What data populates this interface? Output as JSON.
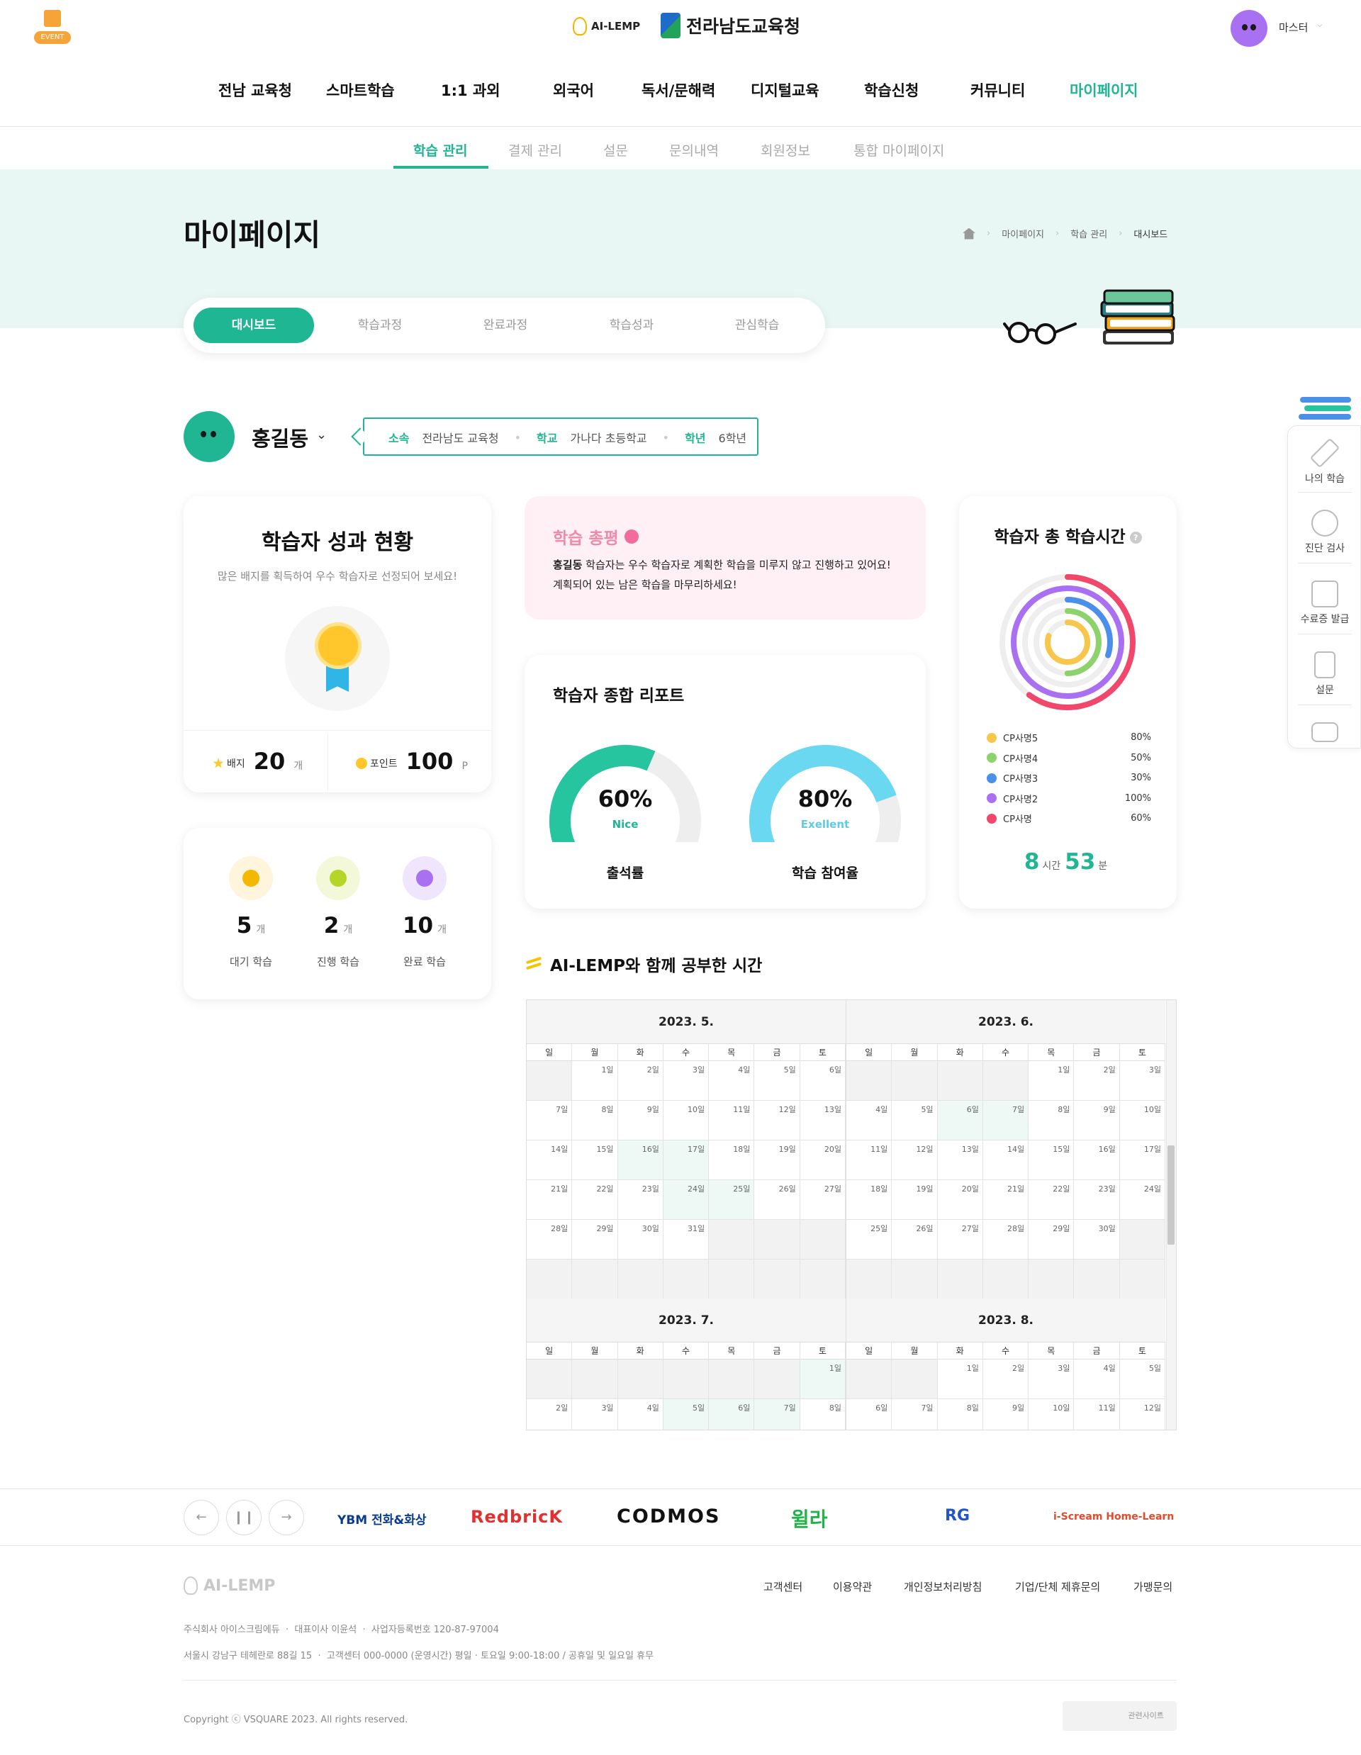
{
  "header": {
    "event_badge": "EVENT",
    "logo_ai": "AI-LEMP",
    "logo_edu": "전라남도교육청",
    "user_name": "마스터"
  },
  "gnb": [
    "전남 교육청",
    "스마트학습",
    "1:1 과외",
    "외국어",
    "독서/문해력",
    "디지털교육",
    "학습신청",
    "커뮤니티",
    "마이페이지"
  ],
  "lnb": [
    "학습 관리",
    "결제 관리",
    "설문",
    "문의내역",
    "회원정보",
    "통합 마이페이지"
  ],
  "page": {
    "title": "마이페이지",
    "breadcrumb": [
      "마이페이지",
      "학습 관리",
      "대시보드"
    ]
  },
  "tabs": [
    "대시보드",
    "학습과정",
    "완료과정",
    "학습성과",
    "관심학습"
  ],
  "profile": {
    "name": "홍길동",
    "affiliation_label": "소속",
    "affiliation": "전라남도 교육청",
    "school_label": "학교",
    "school": "가나다 초등학교",
    "grade_label": "학년",
    "grade": "6학년"
  },
  "performance": {
    "title": "학습자 성과 현황",
    "subtitle": "많은 배지를 획득하여 우수 학습자로 선정되어 보세요!",
    "badge_label": "배지",
    "badge_count": "20",
    "badge_unit": "개",
    "point_label": "포인트",
    "point_count": "100",
    "point_unit": "P"
  },
  "counts": [
    {
      "num": "5",
      "unit": "개",
      "label": "대기 학습",
      "color": "#f5b800",
      "bg": "#fff4dc"
    },
    {
      "num": "2",
      "unit": "개",
      "label": "진행 학습",
      "color": "#b5d629",
      "bg": "#f3f8d8"
    },
    {
      "num": "10",
      "unit": "개",
      "label": "완료 학습",
      "color": "#a971f2",
      "bg": "#efe5fc"
    }
  ],
  "review": {
    "title": "학습 총평",
    "name": "홍길동",
    "body": " 학습자는 우수 학습자로 계획한 학습을 미루지 않고 진행하고 있어요! 계획되어 있는 남은 학습을 마무리하세요!"
  },
  "report": {
    "title": "학습자 종합 리포트",
    "gauges": [
      {
        "value": 0.6,
        "pct": "60%",
        "word": "Nice",
        "label": "출석률",
        "color": "#27c4a0",
        "word_color": "#20b693"
      },
      {
        "value": 0.8,
        "pct": "80%",
        "word": "Exellent",
        "label": "학습 참여율",
        "color": "#6bd8f2",
        "word_color": "#5dcbe8"
      }
    ]
  },
  "study_time": {
    "title": "학습자 총 학습시간",
    "help_icon": "?",
    "legend": [
      {
        "name": "CP사명5",
        "value": "80%",
        "frac": 0.8,
        "color": "#f8c64a"
      },
      {
        "name": "CP사명4",
        "value": "50%",
        "frac": 0.5,
        "color": "#8ed26b"
      },
      {
        "name": "CP사명3",
        "value": "30%",
        "frac": 0.3,
        "color": "#4a8fe8"
      },
      {
        "name": "CP사명2",
        "value": "100%",
        "frac": 1.0,
        "color": "#a971f2"
      },
      {
        "name": "CP사명",
        "value": "60%",
        "frac": 0.6,
        "color": "#f0476b"
      }
    ],
    "hours": "8",
    "hours_unit": "시간",
    "minutes": "53",
    "minutes_unit": "분"
  },
  "calendar": {
    "title": "AI-LEMP와 함께 공부한 시간",
    "weekdays": [
      "일",
      "월",
      "화",
      "수",
      "목",
      "금",
      "토"
    ],
    "months": [
      {
        "label": "2023. 5.",
        "offset": 1,
        "days": 31,
        "highlight": [
          16,
          17,
          24,
          25
        ]
      },
      {
        "label": "2023. 6.",
        "offset": 4,
        "days": 30,
        "highlight": [
          6,
          7
        ]
      },
      {
        "label": "2023. 7.",
        "offset": 6,
        "days": 31,
        "highlight": [
          1,
          5,
          6,
          7
        ]
      },
      {
        "label": "2023. 8.",
        "offset": 2,
        "days": 31,
        "highlight": []
      }
    ],
    "day_suffix": "일"
  },
  "quick_menu": [
    "나의 학습",
    "진단 검사",
    "수료증 발급",
    "설문"
  ],
  "partners": [
    "YBM 전화&화상",
    "RedbricK",
    "CODMOS",
    "윌라",
    "RG",
    "i-Scream Home-Learn"
  ],
  "footer": {
    "logo": "AI-LEMP",
    "links": [
      "고객센터",
      "이용약관",
      "개인정보처리방침",
      "기업/단체 제휴문의",
      "가맹문의"
    ],
    "company": "주식회사 아이스크림에듀",
    "ceo": "대표이사 이윤석",
    "biz_no": "사업자등록번호 120-87-97004",
    "address": "서울시 강남구 테헤란로 88길 15",
    "cs": "고객센터 000-0000 (운영시간) 평일 · 토요일 9:00-18:00 / 공휴일 및 일요일 휴무",
    "copyright": "Copyright ⓒ VSQUARE 2023. All rights reserved.",
    "related": "관련사이트"
  }
}
